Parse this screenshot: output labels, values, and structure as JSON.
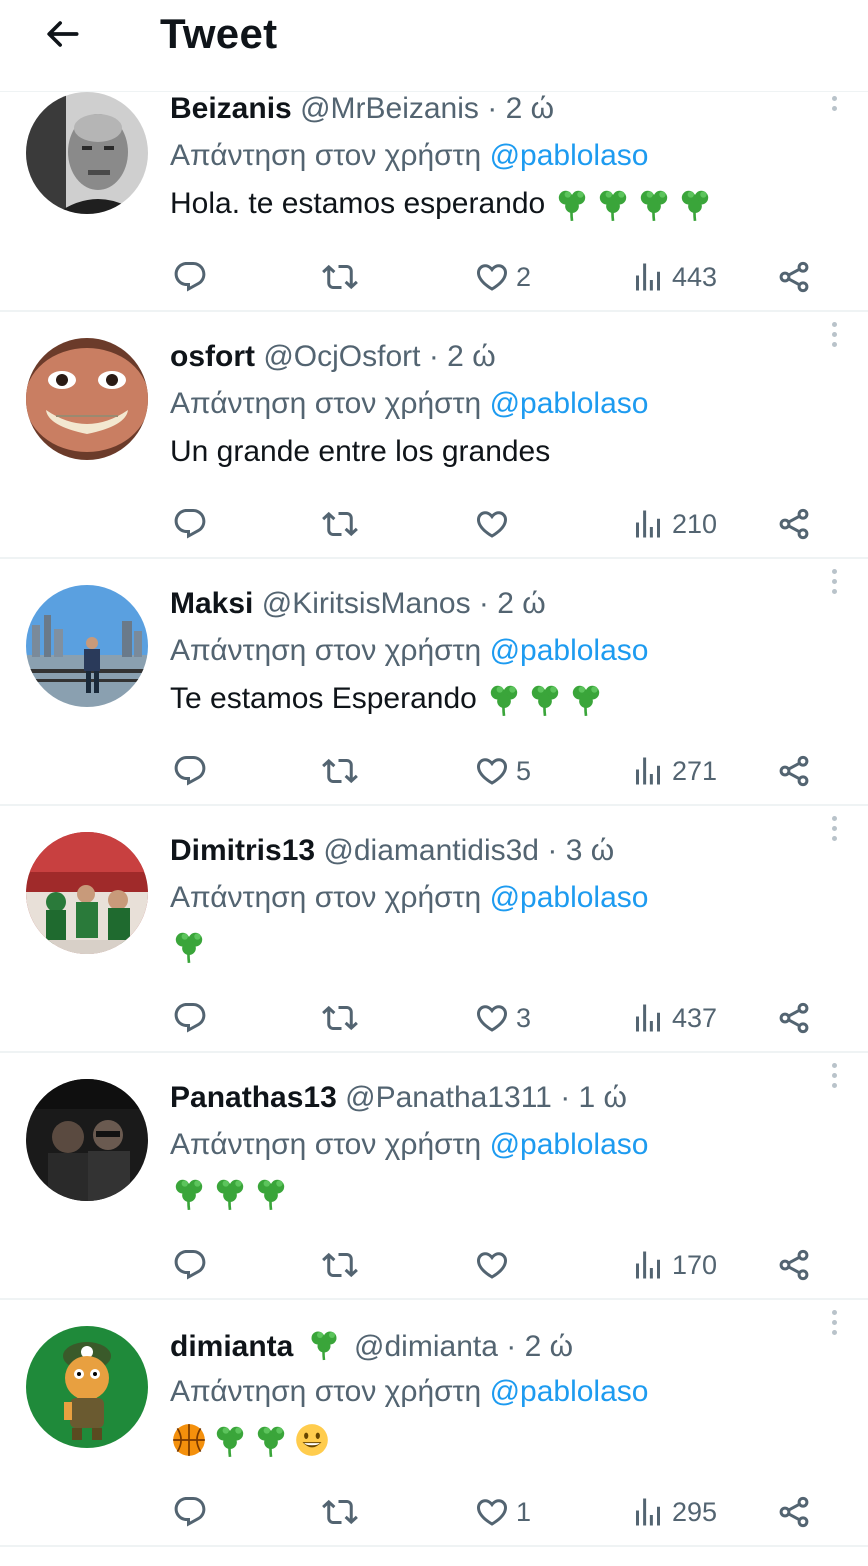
{
  "header": {
    "title": "Tweet"
  },
  "colors": {
    "link": "#1d9bf0",
    "secondary_text": "#536471",
    "divider": "#eff3f4",
    "shamrock": "#3aa53a"
  },
  "replies": [
    {
      "name": "Beizanis",
      "handle": "@MrBeizanis",
      "dot": "·",
      "time": "2 ώ",
      "replying_prefix": "Απάντηση στον χρήστη",
      "mention": "@pablolaso",
      "text": "Hola.  te estamos esperando",
      "text_emojis": [
        "shamrock",
        "shamrock",
        "shamrock",
        "shamrock"
      ],
      "likes": "2",
      "views": "443"
    },
    {
      "name": "osfort",
      "handle": "@OcjOsfort",
      "dot": "·",
      "time": "2 ώ",
      "replying_prefix": "Απάντηση στον χρήστη",
      "mention": "@pablolaso",
      "text": "Un grande entre los grandes",
      "text_emojis": [],
      "likes": "",
      "views": "210"
    },
    {
      "name": "Maksi",
      "handle": "@KiritsisManos",
      "dot": "·",
      "time": "2 ώ",
      "replying_prefix": "Απάντηση στον χρήστη",
      "mention": "@pablolaso",
      "text": "Te estamos Esperando",
      "text_emojis": [
        "shamrock",
        "shamrock",
        "shamrock"
      ],
      "likes": "5",
      "views": "271"
    },
    {
      "name": "Dimitris13",
      "handle": "@diamantidis3d",
      "dot": "·",
      "time": "3 ώ",
      "replying_prefix": "Απάντηση στον χρήστη",
      "mention": "@pablolaso",
      "text": "",
      "text_emojis": [
        "shamrock"
      ],
      "likes": "3",
      "views": "437"
    },
    {
      "name": "Panathas13",
      "handle": "@Panatha1311",
      "dot": "·",
      "time": "1 ώ",
      "replying_prefix": "Απάντηση στον χρήστη",
      "mention": "@pablolaso",
      "text": "",
      "text_emojis": [
        "shamrock",
        "shamrock",
        "shamrock"
      ],
      "likes": "",
      "views": "170"
    },
    {
      "name": "dimianta",
      "name_emoji": "shamrock",
      "handle": "@dimianta",
      "dot": "·",
      "time": "2 ώ",
      "replying_prefix": "Απάντηση στον χρήστη",
      "mention": "@pablolaso",
      "text": "",
      "text_emojis": [
        "basketball",
        "shamrock",
        "shamrock",
        "grinning-face"
      ],
      "likes": "1",
      "views": "295"
    }
  ]
}
